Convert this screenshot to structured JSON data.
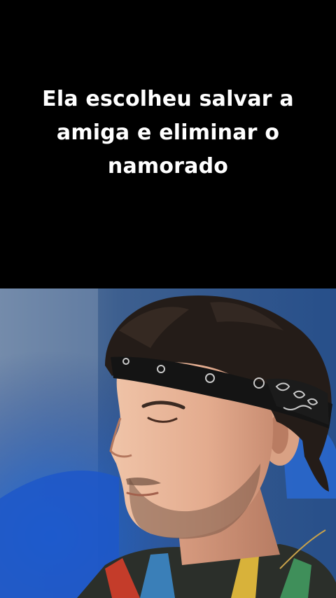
{
  "caption": {
    "lines": [
      "Ela escolheu salvar a",
      "amiga e eliminar o",
      "namorado"
    ]
  },
  "video": {
    "icon": "person-portrait-photo"
  },
  "colors": {
    "background": "#000000",
    "caption_text": "#ffffff",
    "studio_blue": "#1f5fd6"
  }
}
